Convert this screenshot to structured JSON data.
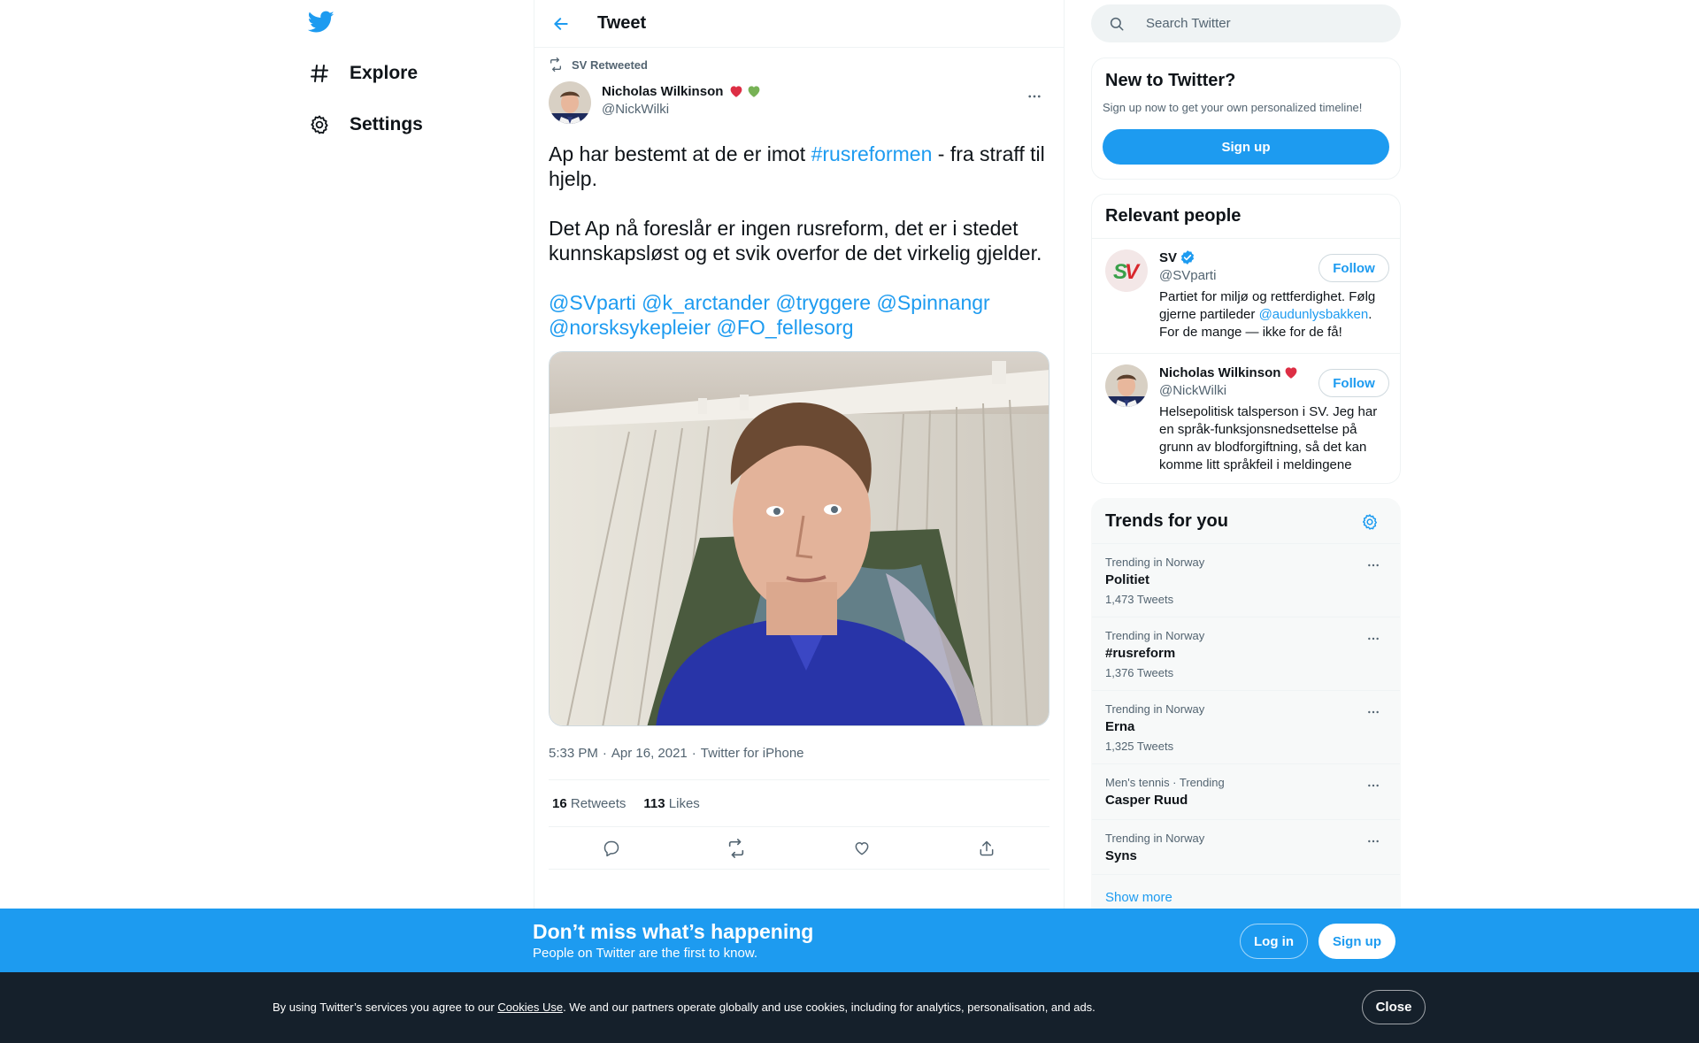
{
  "nav": {
    "items": [
      {
        "label": "Explore",
        "icon": "hashtag-icon"
      },
      {
        "label": "Settings",
        "icon": "gear-icon"
      }
    ]
  },
  "header": {
    "title": "Tweet"
  },
  "tweet": {
    "retweeted_by": "SV Retweeted",
    "author_name": "Nicholas Wilkinson",
    "author_handle": "@NickWilki",
    "emoji": [
      "❤️",
      "💚"
    ],
    "text_p1_a": "Ap har bestemt at de er imot ",
    "text_p1_hashtag": "#rusreformen",
    "text_p1_b": " - fra straff til hjelp.",
    "text_p2": "Det Ap nå foreslår er ingen rusreform, det er i stedet kunnskapsløst og et svik overfor de det virkelig gjelder.",
    "mentions": [
      "@SVparti",
      "@k_arctander",
      "@tryggere",
      "@Spinnangr",
      "@norsksykepleier",
      "@FO_fellesorg"
    ],
    "time": "5:33 PM",
    "date": "Apr 16, 2021",
    "separator": "·",
    "source": "Twitter for iPhone",
    "retweets_count": "16",
    "retweets_label": "Retweets",
    "likes_count": "113",
    "likes_label": "Likes"
  },
  "search": {
    "placeholder": "Search Twitter"
  },
  "new_to_twitter": {
    "title": "New to Twitter?",
    "subtitle": "Sign up now to get your own personalized timeline!",
    "button": "Sign up"
  },
  "relevant_people": {
    "title": "Relevant people",
    "people": [
      {
        "name": "SV",
        "handle": "@SVparti",
        "follow": "Follow",
        "verified": true,
        "bio_a": "Partiet for miljø og rettferdighet. Følg gjerne partileder ",
        "bio_link": "@audunlysbakken",
        "bio_b": ". For de mange — ikke for de få!"
      },
      {
        "name": "Nicholas Wilkinson",
        "handle": "@NickWilki",
        "follow": "Follow",
        "bio": "Helsepolitisk talsperson i SV. Jeg har en språk-funksjonsnedsettelse på grunn av blodforgiftning, så det kan komme litt språkfeil i meldingene"
      }
    ]
  },
  "trends": {
    "title": "Trends for you",
    "items": [
      {
        "category": "Trending in Norway",
        "name": "Politiet",
        "count": "1,473 Tweets"
      },
      {
        "category": "Trending in Norway",
        "name": "#rusreform",
        "count": "1,376 Tweets"
      },
      {
        "category": "Trending in Norway",
        "name": "Erna",
        "count": "1,325 Tweets"
      },
      {
        "category": "Men's tennis · Trending",
        "name": "Casper Ruud",
        "count": ""
      },
      {
        "category": "Trending in Norway",
        "name": "Syns",
        "count": ""
      }
    ],
    "show_more": "Show more"
  },
  "cta": {
    "title": "Don’t miss what’s happening",
    "subtitle": "People on Twitter are the first to know.",
    "login": "Log in",
    "signup": "Sign up"
  },
  "cookie": {
    "text_a": "By using Twitter’s services you agree to our ",
    "link": "Cookies Use",
    "text_b": ". We and our partners operate globally and use cookies, including for analytics, personalisation, and ads.",
    "close": "Close"
  },
  "colors": {
    "accent": "#1d9bf0",
    "text": "#0f1419",
    "secondary": "#536471",
    "cookie_bg": "#15202b"
  }
}
